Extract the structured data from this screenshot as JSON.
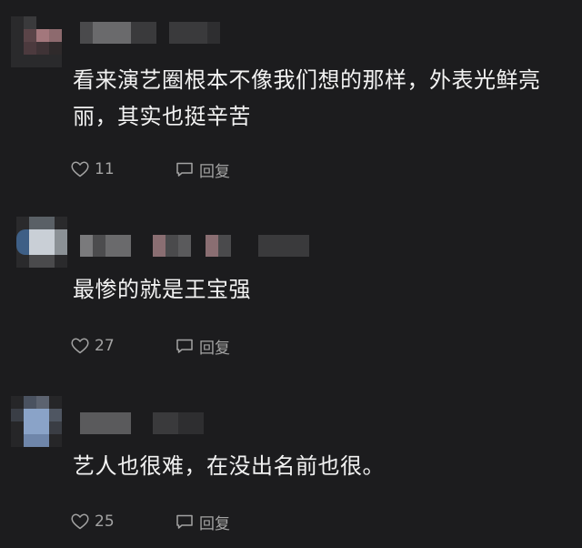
{
  "comments": [
    {
      "text": "看来演艺圈根本不像我们想的那样，外表光鲜亮丽，其实也挺辛苦",
      "like_count": "11",
      "reply_label": "回复"
    },
    {
      "text": "最惨的就是王宝强",
      "like_count": "27",
      "reply_label": "回复"
    },
    {
      "text": "艺人也很难，在没出名前也很。",
      "like_count": "25",
      "reply_label": "回复"
    }
  ],
  "icons": {
    "like": "heart-outline-icon",
    "reply": "speech-bubble-icon"
  },
  "colors": {
    "background": "#1c1c1e",
    "text": "#f2f2f2",
    "meta": "#a3a3a3"
  }
}
